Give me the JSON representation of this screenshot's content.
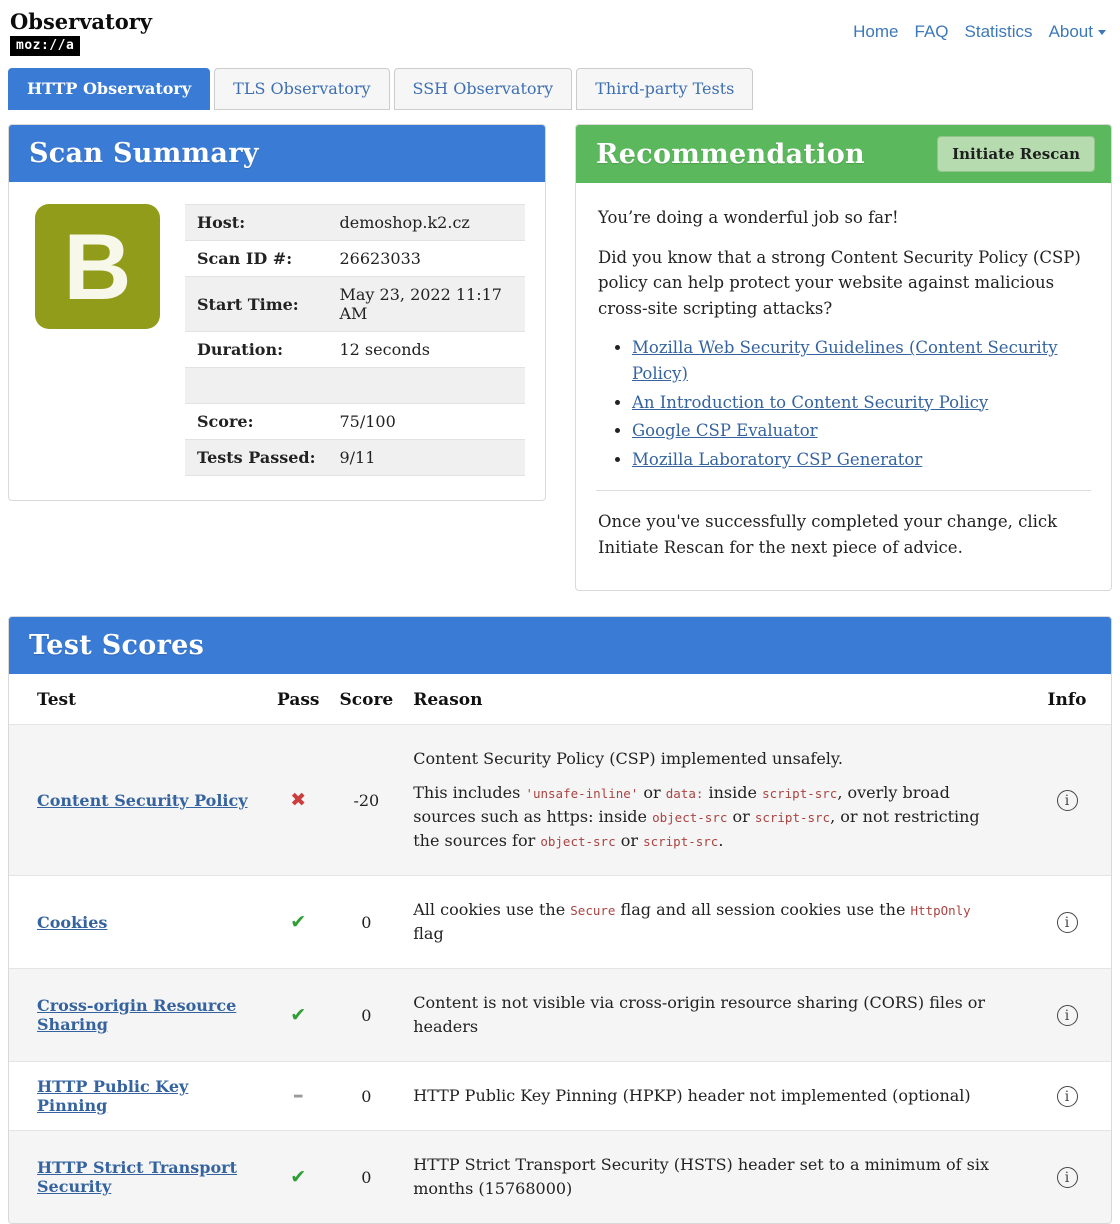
{
  "header": {
    "title": "Observatory",
    "logo": "moz://a",
    "nav": [
      {
        "label": "Home"
      },
      {
        "label": "FAQ"
      },
      {
        "label": "Statistics"
      },
      {
        "label": "About"
      }
    ]
  },
  "tabs": [
    {
      "label": "HTTP Observatory",
      "active": true
    },
    {
      "label": "TLS Observatory",
      "active": false
    },
    {
      "label": "SSH Observatory",
      "active": false
    },
    {
      "label": "Third-party Tests",
      "active": false
    }
  ],
  "scan_summary": {
    "title": "Scan Summary",
    "grade": "B",
    "grade_color": "#929c1b",
    "rows": [
      {
        "label": "Host:",
        "value": "demoshop.k2.cz"
      },
      {
        "label": "Scan ID #:",
        "value": "26623033"
      },
      {
        "label": "Start Time:",
        "value": "May 23, 2022 11:17 AM"
      },
      {
        "label": "Duration:",
        "value": "12 seconds"
      },
      {
        "label": "",
        "value": ""
      },
      {
        "label": "Score:",
        "value": "75/100"
      },
      {
        "label": "Tests Passed:",
        "value": "9/11"
      }
    ]
  },
  "recommendation": {
    "title": "Recommendation",
    "button": "Initiate Rescan",
    "intro": "You’re doing a wonderful job so far!",
    "body": "Did you know that a strong Content Security Policy (CSP) policy can help protect your website against malicious cross-site scripting attacks?",
    "links": [
      "Mozilla Web Security Guidelines (Content Security Policy)",
      "An Introduction to Content Security Policy",
      "Google CSP Evaluator",
      "Mozilla Laboratory CSP Generator"
    ],
    "outro": "Once you've successfully completed your change, click Initiate Rescan for the next piece of advice."
  },
  "test_scores": {
    "title": "Test Scores",
    "columns": [
      "Test",
      "Pass",
      "Score",
      "Reason",
      "Info"
    ],
    "icons": {
      "info": "circled-i",
      "fail": "✖",
      "pass": "✔",
      "neutral": "–"
    },
    "accent_blue": "#3a7bd5",
    "accent_green": "#5cb85c",
    "rows": [
      {
        "test": "Content Security Policy",
        "pass_icon": "✖",
        "pass_state": "fail",
        "score": "-20",
        "reason": [
          [
            {
              "t": "Content Security Policy (CSP) implemented unsafely."
            }
          ],
          [
            {
              "t": "This includes "
            },
            {
              "c": "'unsafe-inline'"
            },
            {
              "t": " or "
            },
            {
              "c": "data:"
            },
            {
              "t": " inside "
            },
            {
              "c": "script-src"
            },
            {
              "t": ", overly broad sources such as https: inside "
            },
            {
              "c": "object-src"
            },
            {
              "t": " or "
            },
            {
              "c": "script-src"
            },
            {
              "t": ", or not restricting the sources for "
            },
            {
              "c": "object-src"
            },
            {
              "t": " or "
            },
            {
              "c": "script-src"
            },
            {
              "t": "."
            }
          ]
        ]
      },
      {
        "test": "Cookies",
        "pass_icon": "✔",
        "pass_state": "pass",
        "score": "0",
        "reason": [
          [
            {
              "t": "All cookies use the "
            },
            {
              "c": "Secure"
            },
            {
              "t": " flag and all session cookies use the "
            },
            {
              "c": "HttpOnly"
            },
            {
              "t": " flag"
            }
          ]
        ]
      },
      {
        "test": "Cross-origin Resource Sharing",
        "pass_icon": "✔",
        "pass_state": "pass",
        "score": "0",
        "reason": [
          [
            {
              "t": "Content is not visible via cross-origin resource sharing (CORS) files or headers"
            }
          ]
        ]
      },
      {
        "test": "HTTP Public Key Pinning",
        "pass_icon": "–",
        "pass_state": "neutral",
        "score": "0",
        "reason": [
          [
            {
              "t": "HTTP Public Key Pinning (HPKP) header not implemented (optional)"
            }
          ]
        ]
      },
      {
        "test": "HTTP Strict Transport Security",
        "pass_icon": "✔",
        "pass_state": "pass",
        "score": "0",
        "reason": [
          [
            {
              "t": "HTTP Strict Transport Security (HSTS) header set to a minimum of six months (15768000)"
            }
          ]
        ]
      }
    ]
  }
}
